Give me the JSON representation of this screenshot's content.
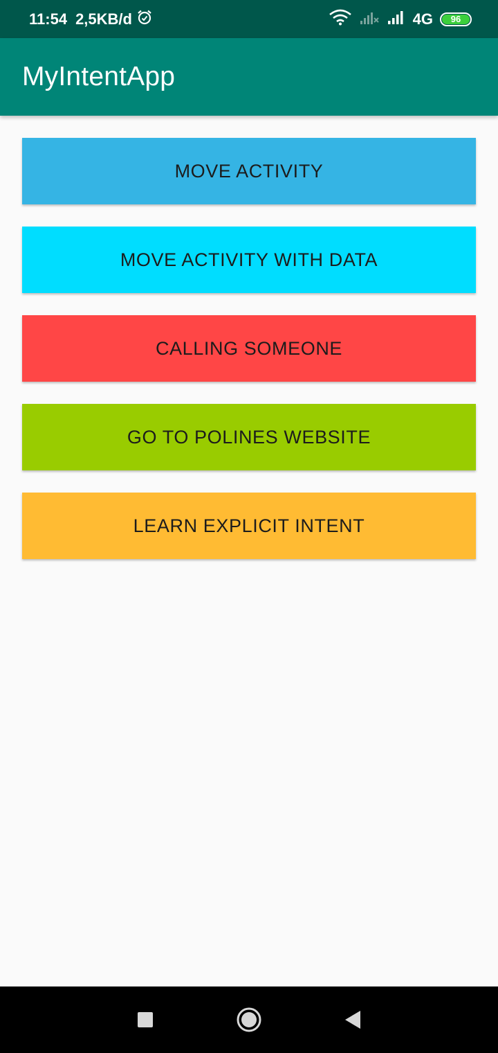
{
  "status_bar": {
    "time": "11:54",
    "data_speed": "2,5KB/d",
    "network_type": "4G",
    "battery_level": "96",
    "icons": [
      "alarm-icon",
      "wifi-icon",
      "no-signal-sim-icon",
      "signal-icon",
      "battery-icon"
    ]
  },
  "app_bar": {
    "title": "MyIntentApp"
  },
  "buttons": [
    {
      "label": "MOVE ACTIVITY",
      "color": "#35b4e4"
    },
    {
      "label": "MOVE ACTIVITY WITH DATA",
      "color": "#00ddff"
    },
    {
      "label": "CALLING SOMEONE",
      "color": "#ff4646"
    },
    {
      "label": "GO TO POLINES WEBSITE",
      "color": "#99cc00"
    },
    {
      "label": "LEARN EXPLICIT INTENT",
      "color": "#ffbb33"
    }
  ],
  "nav_bar": {
    "icons": [
      "recents-icon",
      "home-icon",
      "back-icon"
    ]
  },
  "colors": {
    "status_bar": "#00574b",
    "app_bar": "#008577",
    "background": "#fafafa"
  }
}
